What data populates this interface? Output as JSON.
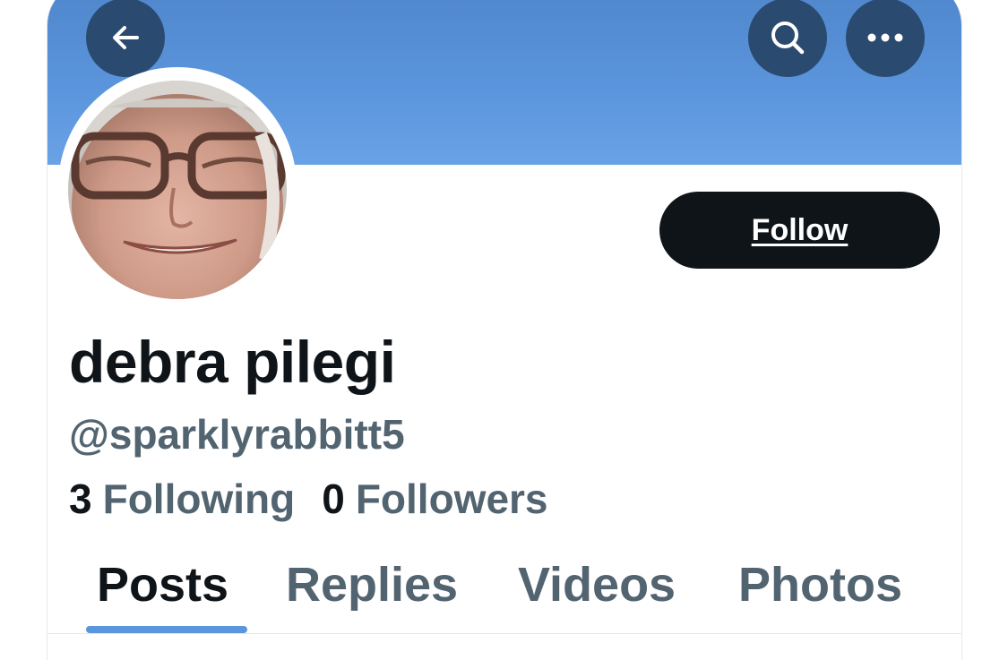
{
  "header": {
    "back_icon": "arrow-left-icon",
    "search_icon": "search-icon",
    "more_icon": "more-horizontal-icon",
    "banner_color": "#5b95dc",
    "button_color": "#2b4a6f"
  },
  "profile": {
    "display_name": "debra pilegi",
    "handle": "@sparklyrabbitt5",
    "follow_label": "Follow",
    "avatar": "profile-photo"
  },
  "stats": {
    "following_count": "3",
    "following_label": "Following",
    "followers_count": "0",
    "followers_label": "Followers"
  },
  "tabs": [
    {
      "label": "Posts",
      "active": true
    },
    {
      "label": "Replies",
      "active": false
    },
    {
      "label": "Videos",
      "active": false
    },
    {
      "label": "Photos",
      "active": false
    }
  ],
  "colors": {
    "primary_text": "#0f1419",
    "secondary_text": "#536471",
    "accent": "#5b95dc"
  }
}
